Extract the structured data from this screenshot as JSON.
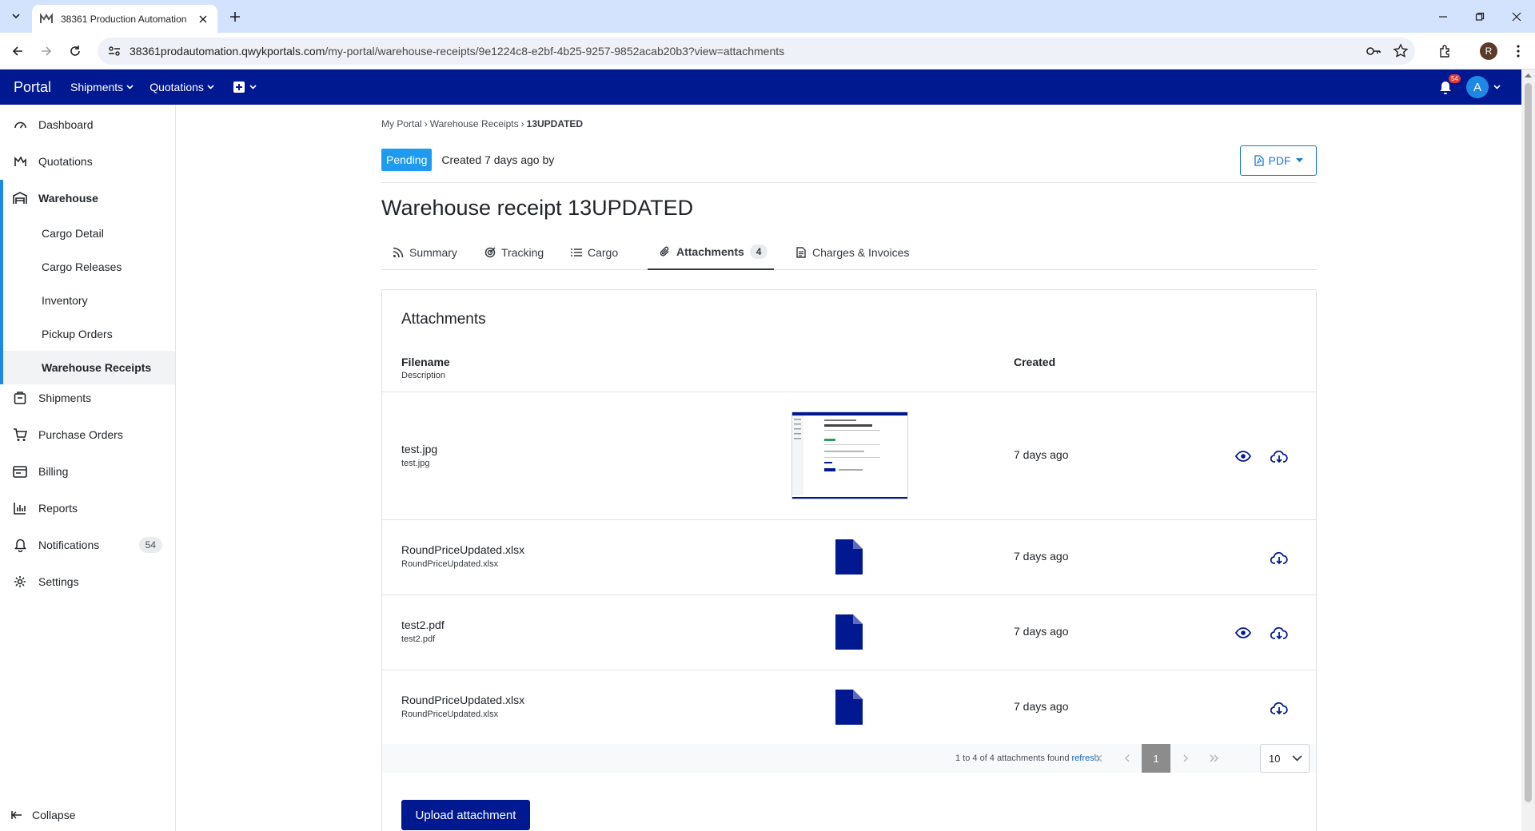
{
  "browser": {
    "tab_title": "38361 Production Automation",
    "url_host": "38361prodautomation.qwykportals.com",
    "url_path": "/my-portal/warehouse-receipts/9e1224c8-e2bf-4b25-9257-9852acab20b3?view=attachments",
    "profile_initial": "R"
  },
  "navbar": {
    "brand": "Portal",
    "menus": [
      {
        "label": "Shipments"
      },
      {
        "label": "Quotations"
      }
    ],
    "notification_count": "54",
    "user_initial": "A"
  },
  "sidebar": {
    "items": [
      {
        "label": "Dashboard",
        "icon": "dashboard-icon"
      },
      {
        "label": "Quotations",
        "icon": "quotations-icon"
      },
      {
        "label": "Warehouse",
        "icon": "warehouse-icon"
      },
      {
        "label": "Shipments",
        "icon": "shipments-icon"
      },
      {
        "label": "Purchase Orders",
        "icon": "cart-icon"
      },
      {
        "label": "Billing",
        "icon": "billing-icon"
      },
      {
        "label": "Reports",
        "icon": "reports-icon"
      },
      {
        "label": "Notifications",
        "icon": "bell-icon",
        "badge": "54"
      },
      {
        "label": "Settings",
        "icon": "gear-icon"
      }
    ],
    "warehouse_sub": [
      {
        "label": "Cargo Detail"
      },
      {
        "label": "Cargo Releases"
      },
      {
        "label": "Inventory"
      },
      {
        "label": "Pickup Orders"
      },
      {
        "label": "Warehouse Receipts"
      }
    ],
    "collapse_label": "Collapse"
  },
  "page": {
    "breadcrumb": [
      "My Portal",
      "Warehouse Receipts",
      "13UPDATED"
    ],
    "status": "Pending",
    "created_by": "Created 7 days ago by",
    "pdf_label": "PDF",
    "title": "Warehouse receipt 13UPDATED",
    "tabs": [
      {
        "label": "Summary",
        "icon": "rss-icon"
      },
      {
        "label": "Tracking",
        "icon": "tracking-icon"
      },
      {
        "label": "Cargo",
        "icon": "list-icon"
      },
      {
        "label": "Attachments",
        "icon": "paperclip-icon",
        "count": "4"
      },
      {
        "label": "Charges & Invoices",
        "icon": "invoice-icon"
      }
    ]
  },
  "attachments": {
    "card_title": "Attachments",
    "col_filename": "Filename",
    "col_description": "Description",
    "col_created": "Created",
    "rows": [
      {
        "filename": "test.jpg",
        "description": "test.jpg",
        "created": "7 days ago",
        "preview": "image-thumbnail",
        "viewable": true
      },
      {
        "filename": "RoundPriceUpdated.xlsx",
        "description": "RoundPriceUpdated.xlsx",
        "created": "7 days ago",
        "preview": "file-icon",
        "viewable": false
      },
      {
        "filename": "test2.pdf",
        "description": "test2.pdf",
        "created": "7 days ago",
        "preview": "file-icon",
        "viewable": true
      },
      {
        "filename": "RoundPriceUpdated.xlsx",
        "description": "RoundPriceUpdated.xlsx",
        "created": "7 days ago",
        "preview": "file-icon",
        "viewable": false
      }
    ],
    "pager_text": "1 to 4 of 4 attachments found",
    "refresh_label": "refresh",
    "current_page": "1",
    "page_size": "10",
    "upload_label": "Upload attachment"
  },
  "colors": {
    "navbar": "#001991",
    "accent": "#1e88e5",
    "status_pending": "#1e9bf0"
  }
}
